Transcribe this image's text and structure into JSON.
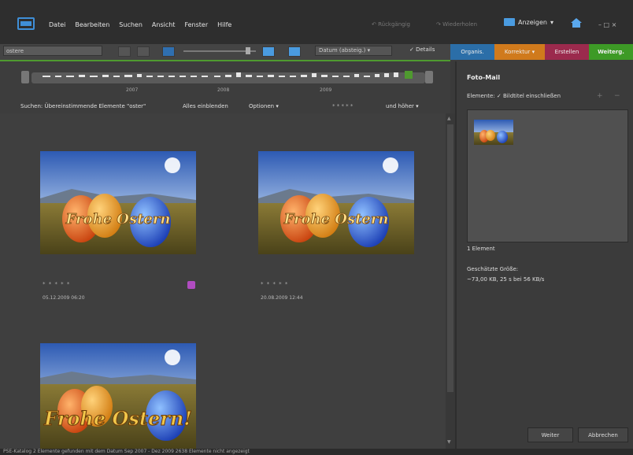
{
  "menu": {
    "items": [
      "Datei",
      "Bearbeiten",
      "Suchen",
      "Ansicht",
      "Fenster",
      "Hilfe"
    ],
    "undo_label": "Rückgängig",
    "redo_label": "Wiederholen",
    "show_label": "Anzeigen",
    "window_controls": "– □ ×"
  },
  "toolbar": {
    "search_value": "ostere",
    "sort_label": "Datum (absteig.)",
    "details_label": "Details"
  },
  "mode_tabs": [
    {
      "label": "Organis.",
      "color": "#2b6ea8"
    },
    {
      "label": "Korrektur",
      "color": "#d07a1c"
    },
    {
      "label": "Erstellen",
      "color": "#9b2a4d"
    },
    {
      "label": "Weiterg.",
      "color": "#3d9a26"
    }
  ],
  "timeline": {
    "years": [
      "2007",
      "2008",
      "2009"
    ]
  },
  "filterbar": {
    "search_desc": "Suchen: Übereinstimmende Elemente \"oster\"",
    "show_all": "Alles einblenden",
    "options": "Optionen",
    "stars": "* * * * *",
    "rating_filter": "und höher"
  },
  "grid": {
    "items": [
      {
        "caption": "Frohe Ostern",
        "stars": "* * * * *",
        "date": "05.12.2009 06:20"
      },
      {
        "caption": "Frohe Ostern",
        "stars": "* * * * *",
        "date": "20.08.2009 12:44"
      },
      {
        "caption": "Frohe Ostern!"
      }
    ]
  },
  "panel": {
    "title": "Foto-Mail",
    "elements_label": "Elemente:",
    "caption_checkbox": "Bildtitel einschließen",
    "count": "1 Element",
    "size_label": "Geschätzte Größe:",
    "size_value": "~73,00 KB, 25 s bei 56 KB/s",
    "next": "Weiter",
    "cancel": "Abbrechen"
  },
  "status": {
    "text": "PSE-Katalog  2 Elemente gefunden mit dem Datum Sep 2007 - Dez 2009  2638 Elemente nicht angezeigt"
  }
}
